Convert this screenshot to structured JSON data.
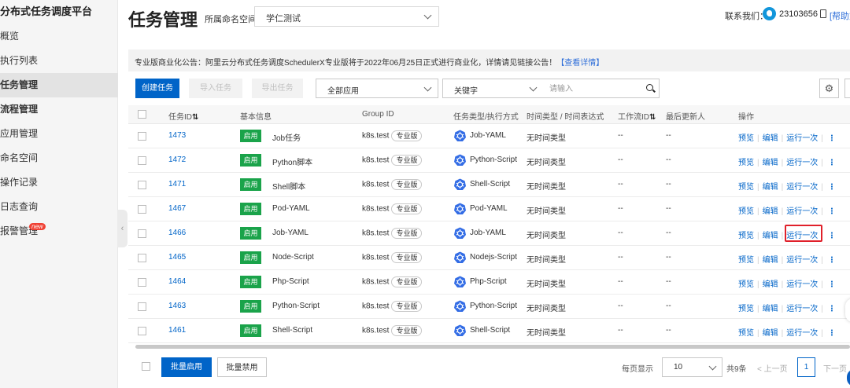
{
  "sidebar": {
    "title": "分布式任务调度平台",
    "items": [
      {
        "label": "概览"
      },
      {
        "label": "执行列表"
      },
      {
        "label": "任务管理"
      },
      {
        "label": "流程管理"
      },
      {
        "label": "应用管理"
      },
      {
        "label": "命名空间"
      },
      {
        "label": "操作记录"
      },
      {
        "label": "日志查询"
      },
      {
        "label": "报警管理",
        "badge": "new"
      }
    ],
    "active": "任务管理",
    "collapse_glyph": "‹"
  },
  "header": {
    "title": "任务管理",
    "namespace_label": "所属命名空间：",
    "namespace_value": "学仁测试",
    "contact_label": "联系我们：",
    "contact_number": "23103656",
    "help_link": "[帮助文"
  },
  "notice": {
    "text": "专业版商业化公告：阿里云分布式任务调度SchedulerX专业版将于2022年06月25日正式进行商业化，详情请见链接公告！",
    "link": "【查看详情】"
  },
  "toolbar": {
    "create": "创建任务",
    "import": "导入任务",
    "export": "导出任务",
    "app_filter": "全部应用",
    "keyword_filter": "关键字",
    "search_placeholder": "请输入",
    "gear_glyph": "⚙"
  },
  "table": {
    "columns": {
      "id": "任务ID",
      "basic": "基本信息",
      "group": "Group ID",
      "type": "任务类型/执行方式",
      "time": "时间类型 / 时间表达式",
      "workflow": "工作流ID",
      "updater": "最后更新人",
      "ops": "操作"
    },
    "sort_glyph": "⇅",
    "rows": [
      {
        "id": "1473",
        "status": "启用",
        "name": "Job任务",
        "group": "k8s.test",
        "edition": "专业版",
        "type": "Job-YAML",
        "time": "无时间类型",
        "workflow": "--",
        "updater": "--"
      },
      {
        "id": "1472",
        "status": "启用",
        "name": "Python脚本",
        "group": "k8s.test",
        "edition": "专业版",
        "type": "Python-Script",
        "time": "无时间类型",
        "workflow": "--",
        "updater": "--"
      },
      {
        "id": "1471",
        "status": "启用",
        "name": "Shell脚本",
        "group": "k8s.test",
        "edition": "专业版",
        "type": "Shell-Script",
        "time": "无时间类型",
        "workflow": "--",
        "updater": "--"
      },
      {
        "id": "1467",
        "status": "启用",
        "name": "Pod-YAML",
        "group": "k8s.test",
        "edition": "专业版",
        "type": "Pod-YAML",
        "time": "无时间类型",
        "workflow": "--",
        "updater": "--"
      },
      {
        "id": "1466",
        "status": "启用",
        "name": "Job-YAML",
        "group": "k8s.test",
        "edition": "专业版",
        "type": "Job-YAML",
        "time": "无时间类型",
        "workflow": "--",
        "updater": "--"
      },
      {
        "id": "1465",
        "status": "启用",
        "name": "Node-Script",
        "group": "k8s.test",
        "edition": "专业版",
        "type": "Nodejs-Script",
        "time": "无时间类型",
        "workflow": "--",
        "updater": "--"
      },
      {
        "id": "1464",
        "status": "启用",
        "name": "Php-Script",
        "group": "k8s.test",
        "edition": "专业版",
        "type": "Php-Script",
        "time": "无时间类型",
        "workflow": "--",
        "updater": "--"
      },
      {
        "id": "1463",
        "status": "启用",
        "name": "Python-Script",
        "group": "k8s.test",
        "edition": "专业版",
        "type": "Python-Script",
        "time": "无时间类型",
        "workflow": "--",
        "updater": "--"
      },
      {
        "id": "1461",
        "status": "启用",
        "name": "Shell-Script",
        "group": "k8s.test",
        "edition": "专业版",
        "type": "Shell-Script",
        "time": "无时间类型",
        "workflow": "--",
        "updater": "--"
      }
    ],
    "ops": {
      "preview": "预览",
      "edit": "编辑",
      "run_once": "运行一次",
      "more": "⋮"
    },
    "highlighted_row_id": "1466"
  },
  "footer": {
    "bulk_enable": "批量启用",
    "bulk_disable": "批量禁用",
    "page_size_label": "每页显示",
    "page_size": "10",
    "total": "共9条",
    "prev": "< 上一页",
    "current_page": "1",
    "next": "下一页"
  },
  "colors": {
    "primary": "#0064c8",
    "enabled_tag": "#1aa34a",
    "highlight": "#e0202a"
  }
}
